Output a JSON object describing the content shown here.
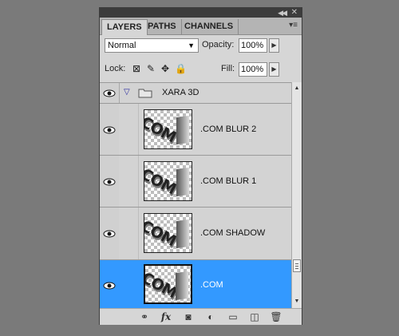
{
  "panel": {
    "tabs": [
      {
        "label": "LAYERS",
        "active": true
      },
      {
        "label": "PATHS",
        "active": false
      },
      {
        "label": "CHANNELS",
        "active": false
      }
    ],
    "blend_mode": "Normal",
    "opacity_label": "Opacity:",
    "opacity_value": "100%",
    "lock_label": "Lock:",
    "fill_label": "Fill:",
    "fill_value": "100%"
  },
  "layers": {
    "group": {
      "name": "XARA 3D",
      "expanded": true
    },
    "items": [
      {
        "name": ".COM BLUR 2",
        "thumb_text": "COM",
        "selected": false
      },
      {
        "name": ".COM BLUR 1",
        "thumb_text": "COM",
        "selected": false
      },
      {
        "name": ".COM SHADOW",
        "thumb_text": "COM",
        "selected": false
      },
      {
        "name": ".COM",
        "thumb_text": "COM",
        "selected": true
      }
    ]
  },
  "bottom_icons": [
    "link-icon",
    "fx-icon",
    "mask-icon",
    "adjustment-icon",
    "folder-icon",
    "new-layer-icon",
    "trash-icon"
  ],
  "colors": {
    "selection": "#3399ff",
    "panel_bg": "#d6d6d6",
    "desktop_bg": "#7a7a7a"
  }
}
